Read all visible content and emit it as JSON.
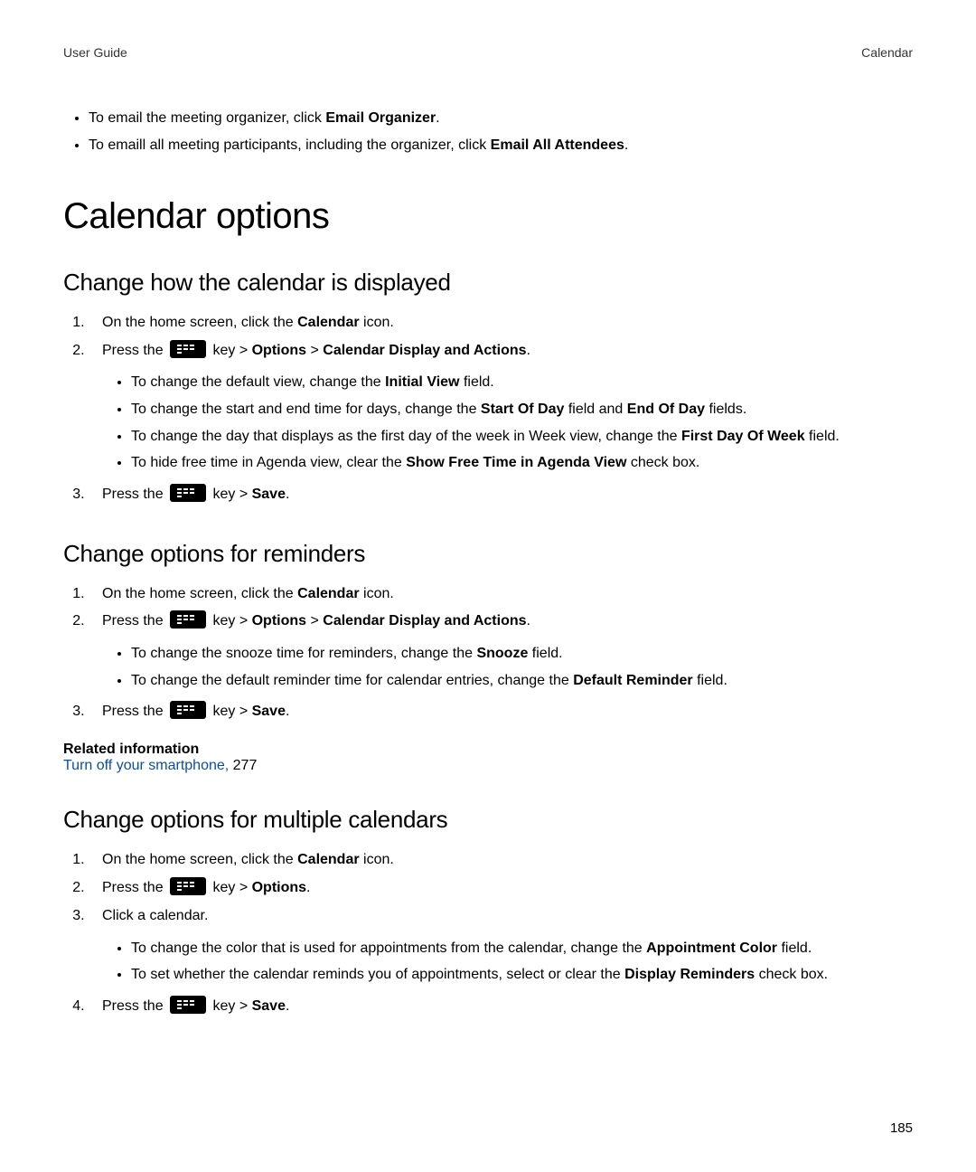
{
  "header": {
    "left": "User Guide",
    "right": "Calendar"
  },
  "topBullets": [
    {
      "pre": "To email the meeting organizer, click ",
      "bold": "Email Organizer",
      "post": "."
    },
    {
      "pre": "To emaill all meeting participants, including the organizer, click ",
      "bold": "Email All Attendees",
      "post": "."
    }
  ],
  "h1": "Calendar options",
  "sec1": {
    "title": "Change how the calendar is displayed",
    "step1_pre": "On the home screen, click the ",
    "step1_bold": "Calendar",
    "step1_post": " icon.",
    "step2_pre": "Press the ",
    "step2_key": " key > ",
    "step2_b1": "Options",
    "step2_gt": " > ",
    "step2_b2": "Calendar Display and Actions",
    "step2_post": ".",
    "sub": [
      {
        "pre": "To change the default view, change the ",
        "bold": "Initial View",
        "post": " field."
      },
      {
        "pre": "To change the start and end time for days, change the ",
        "bold": "Start Of Day",
        "mid": " field and ",
        "bold2": "End Of Day",
        "post": " fields."
      },
      {
        "pre": "To change the day that displays as the first day of the week in Week view, change the ",
        "bold": "First Day Of Week",
        "post": " field."
      },
      {
        "pre": "To hide free time in Agenda view, clear the ",
        "bold": "Show Free Time in Agenda View",
        "post": " check box."
      }
    ],
    "step3_pre": "Press the ",
    "step3_key": " key > ",
    "step3_bold": "Save",
    "step3_post": "."
  },
  "sec2": {
    "title": "Change options for reminders",
    "step1_pre": "On the home screen, click the ",
    "step1_bold": "Calendar",
    "step1_post": " icon.",
    "step2_pre": "Press the ",
    "step2_key": " key > ",
    "step2_b1": "Options",
    "step2_gt": " > ",
    "step2_b2": "Calendar Display and Actions",
    "step2_post": ".",
    "sub": [
      {
        "pre": "To change the snooze time for reminders, change the ",
        "bold": "Snooze",
        "post": " field."
      },
      {
        "pre": "To change the default reminder time for calendar entries, change the ",
        "bold": "Default Reminder",
        "post": " field."
      }
    ],
    "step3_pre": "Press the ",
    "step3_key": " key > ",
    "step3_bold": "Save",
    "step3_post": ".",
    "related_heading": "Related information",
    "related_link": "Turn off your smartphone,",
    "related_page": " 277"
  },
  "sec3": {
    "title": "Change options for multiple calendars",
    "step1_pre": "On the home screen, click the ",
    "step1_bold": "Calendar",
    "step1_post": " icon.",
    "step2_pre": "Press the ",
    "step2_key": " key > ",
    "step2_bold": "Options",
    "step2_post": ".",
    "step3": "Click a calendar.",
    "sub": [
      {
        "pre": "To change the color that is used for appointments from the calendar, change the ",
        "bold": "Appointment Color",
        "post": " field."
      },
      {
        "pre": "To set whether the calendar reminds you of appointments, select or clear the ",
        "bold": "Display Reminders",
        "post": " check box."
      }
    ],
    "step4_pre": "Press the ",
    "step4_key": " key > ",
    "step4_bold": "Save",
    "step4_post": "."
  },
  "pageNumber": "185"
}
